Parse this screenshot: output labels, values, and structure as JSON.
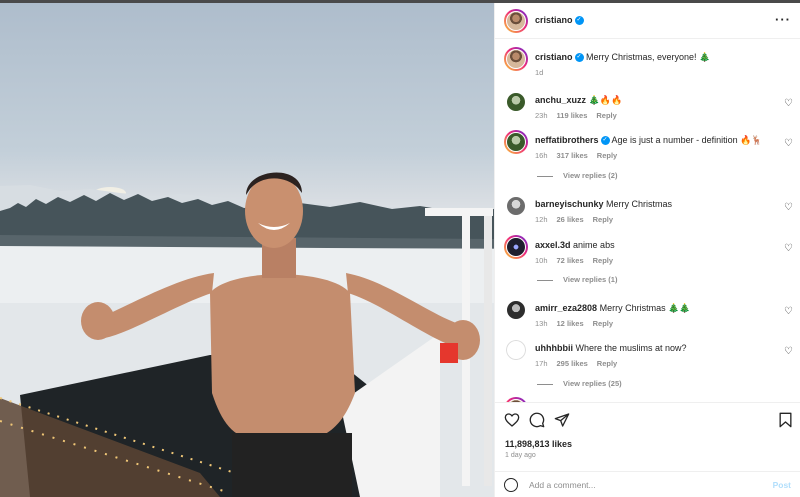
{
  "post": {
    "author": "cristiano",
    "caption": "Merry Christmas, everyone! 🎄",
    "caption_age": "1d",
    "likes": "11,898,813 likes",
    "age": "1 day ago"
  },
  "comments": [
    {
      "user": "anchu_xuzz",
      "text": "🎄🔥🔥",
      "age": "23h",
      "likes": "119 likes",
      "reply": "Reply"
    },
    {
      "user": "neffatibrothers",
      "verified": true,
      "text": "Age is just a number - definition 🔥🦌",
      "age": "16h",
      "likes": "317 likes",
      "reply": "Reply",
      "view_replies": "View replies (2)"
    },
    {
      "user": "barneyischunky",
      "text": "Merry Christmas",
      "age": "12h",
      "likes": "26 likes",
      "reply": "Reply"
    },
    {
      "user": "axxel.3d",
      "text": "anime abs",
      "age": "10h",
      "likes": "72 likes",
      "reply": "Reply",
      "view_replies": "View replies (1)"
    },
    {
      "user": "amirr_eza2808",
      "text": "Merry Christmas 🎄🎄",
      "age": "13h",
      "likes": "12 likes",
      "reply": "Reply"
    },
    {
      "user": "uhhhbbii",
      "text": "Where the muslims at now?",
      "age": "17h",
      "likes": "295 likes",
      "reply": "Reply",
      "view_replies": "View replies (25)"
    }
  ],
  "icons": {
    "like": "heart-icon",
    "comment": "comment-icon",
    "share": "share-icon",
    "save": "bookmark-icon",
    "more": "more-icon",
    "emoji": "emoji-icon"
  },
  "add_comment": {
    "placeholder": "Add a comment...",
    "post_label": "Post"
  },
  "colors": {
    "verified": "#0095f6",
    "post_button_disabled": "#b2dffc",
    "muted_text": "#8e8e8e"
  }
}
